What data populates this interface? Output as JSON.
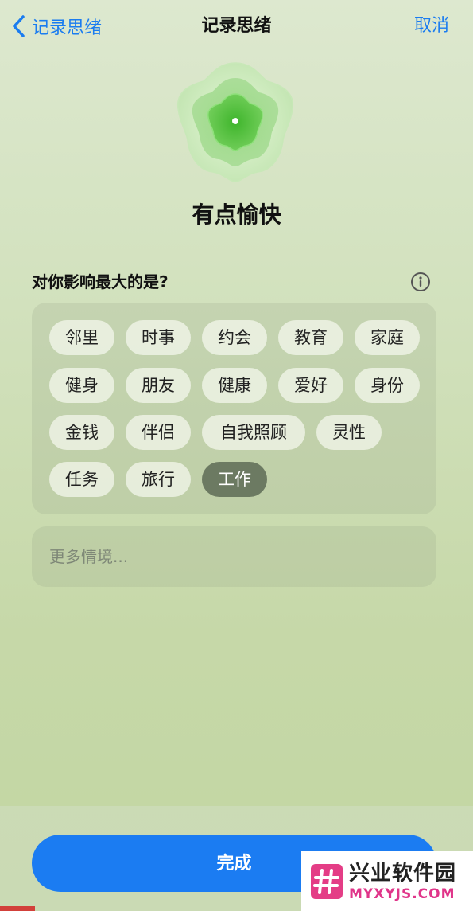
{
  "nav": {
    "back_label": "记录思绪",
    "title": "记录思绪",
    "cancel_label": "取消"
  },
  "mood": {
    "icon": "flower-icon",
    "label": "有点愉快",
    "color": "#5fc24a"
  },
  "question": {
    "text": "对你影响最大的是?",
    "info_icon": "info-icon"
  },
  "tags": {
    "row1": [
      "邻里",
      "时事",
      "约会",
      "教育",
      "家庭"
    ],
    "row2": [
      "健身",
      "朋友",
      "健康",
      "爱好",
      "身份"
    ],
    "row3": [
      "金钱",
      "伴侣",
      "自我照顾",
      "灵性"
    ],
    "row4": [
      "任务",
      "旅行",
      "工作"
    ],
    "selected": "工作"
  },
  "more_input": {
    "placeholder": "更多情境..."
  },
  "done_label": "完成",
  "colors": {
    "accent": "#1b7cf2",
    "selected_tag": "#6c7a62"
  },
  "watermark": {
    "cn": "兴业软件园",
    "en": "MYXYJS.COM"
  }
}
